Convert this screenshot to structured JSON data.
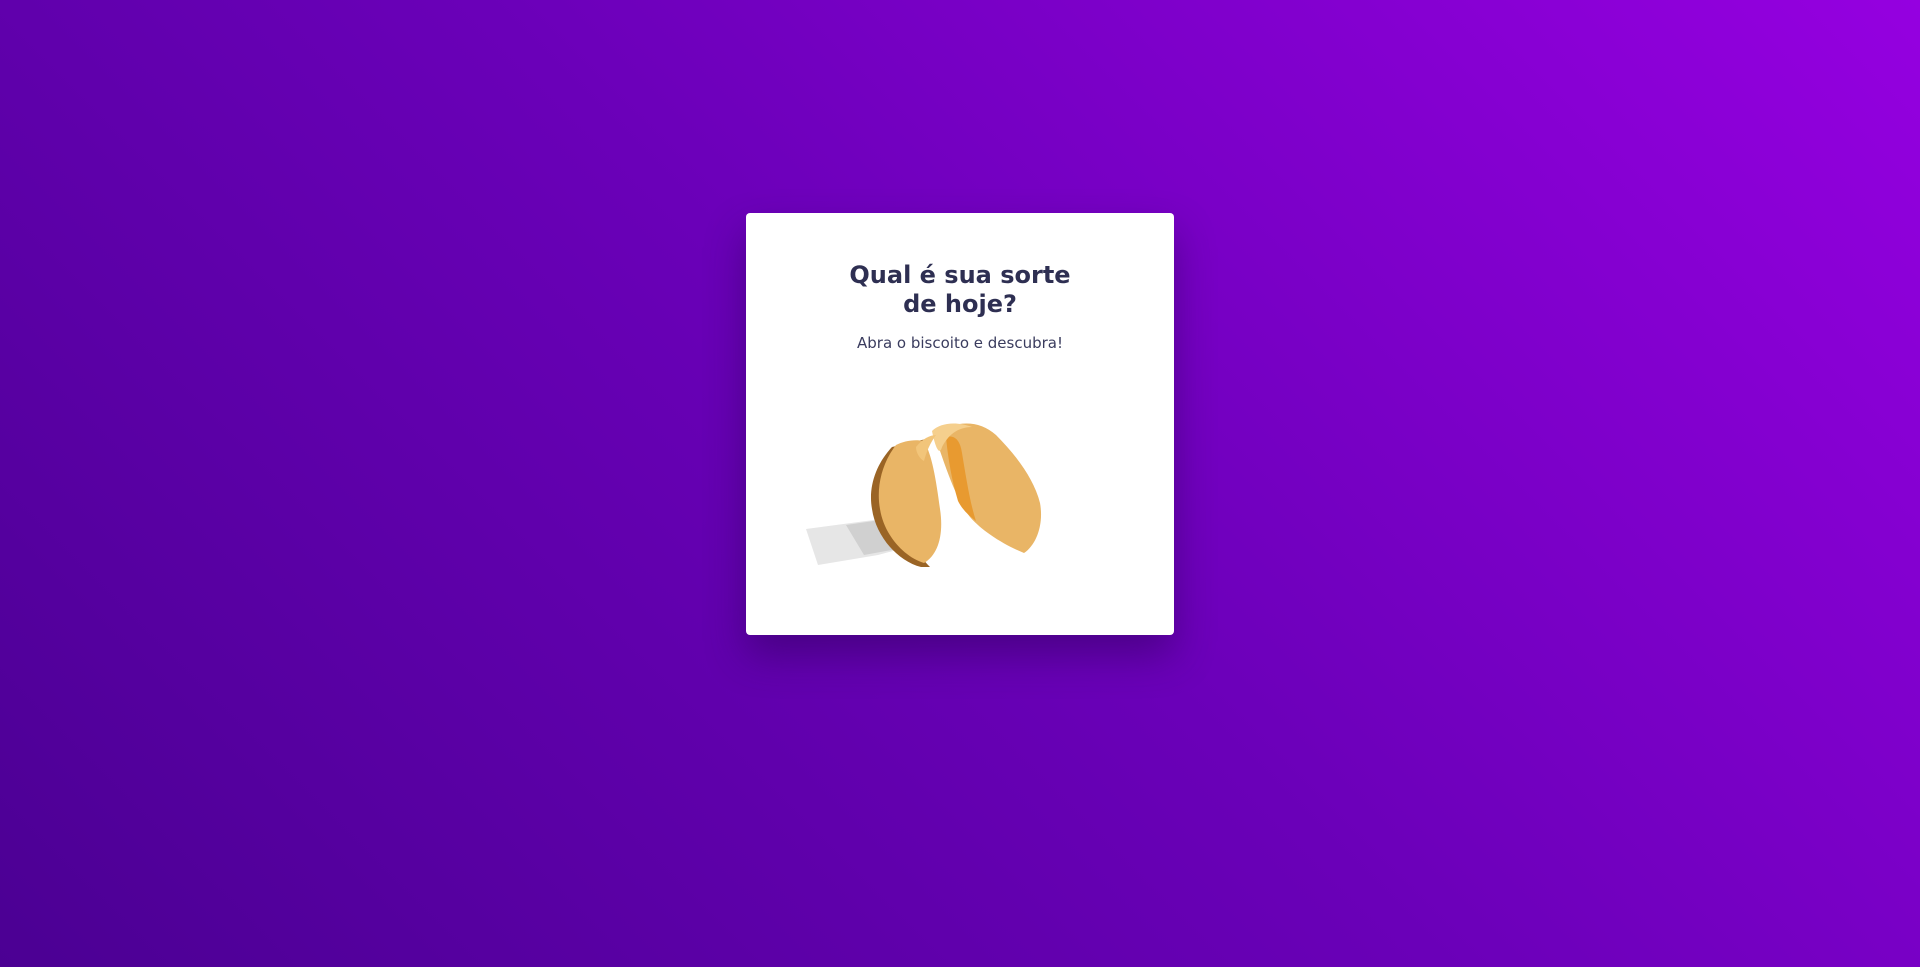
{
  "card": {
    "title": "Qual é sua sorte\nde hoje?",
    "subtitle": "Abra o biscoito e descubra!"
  },
  "cookie": {
    "icon": "fortune-cookie-icon"
  },
  "colors": {
    "background_start": "#4b0093",
    "background_end": "#9500e0",
    "card": "#ffffff",
    "title_text": "#2e2f52",
    "cookie": "#e9b566",
    "cookie_shadow": "#e89a30"
  }
}
